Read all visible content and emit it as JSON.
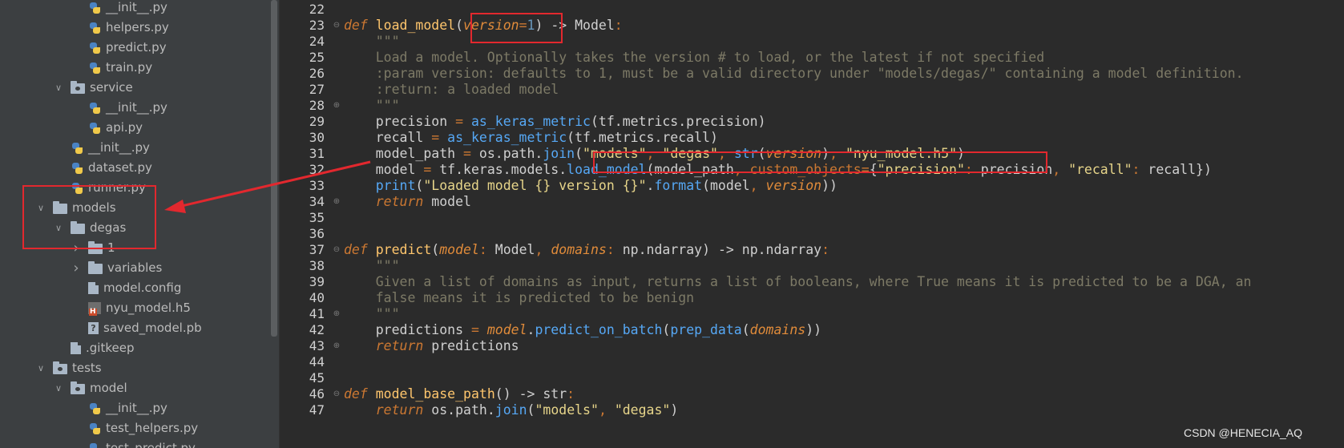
{
  "sidebar": {
    "items": [
      {
        "label": "__init__.py",
        "icon": "python-file-icon",
        "depth": 3,
        "chevron": ""
      },
      {
        "label": "helpers.py",
        "icon": "python-file-icon",
        "depth": 3,
        "chevron": ""
      },
      {
        "label": "predict.py",
        "icon": "python-file-icon",
        "depth": 3,
        "chevron": ""
      },
      {
        "label": "train.py",
        "icon": "python-file-icon",
        "depth": 3,
        "chevron": ""
      },
      {
        "label": "service",
        "icon": "package-folder-icon",
        "depth": 2,
        "chevron": "down"
      },
      {
        "label": "__init__.py",
        "icon": "python-file-icon",
        "depth": 3,
        "chevron": ""
      },
      {
        "label": "api.py",
        "icon": "python-file-icon",
        "depth": 3,
        "chevron": ""
      },
      {
        "label": "__init__.py",
        "icon": "python-file-icon",
        "depth": 2,
        "chevron": ""
      },
      {
        "label": "dataset.py",
        "icon": "python-file-icon",
        "depth": 2,
        "chevron": ""
      },
      {
        "label": "runner.py",
        "icon": "python-file-icon",
        "depth": 2,
        "chevron": ""
      },
      {
        "label": "models",
        "icon": "folder-icon",
        "depth": 1,
        "chevron": "down"
      },
      {
        "label": "degas",
        "icon": "folder-icon",
        "depth": 2,
        "chevron": "down"
      },
      {
        "label": "1",
        "icon": "folder-icon",
        "depth": 3,
        "chevron": "right"
      },
      {
        "label": "variables",
        "icon": "folder-icon",
        "depth": 3,
        "chevron": "right"
      },
      {
        "label": "model.config",
        "icon": "generic-file-icon",
        "depth": 3,
        "chevron": ""
      },
      {
        "label": "nyu_model.h5",
        "icon": "h5-file-icon",
        "depth": 3,
        "chevron": ""
      },
      {
        "label": "saved_model.pb",
        "icon": "unknown-file-icon",
        "depth": 3,
        "chevron": ""
      },
      {
        "label": ".gitkeep",
        "icon": "generic-file-icon",
        "depth": 2,
        "chevron": ""
      },
      {
        "label": "tests",
        "icon": "package-folder-icon",
        "depth": 1,
        "chevron": "down"
      },
      {
        "label": "model",
        "icon": "package-folder-icon",
        "depth": 2,
        "chevron": "down"
      },
      {
        "label": "__init__.py",
        "icon": "python-file-icon",
        "depth": 3,
        "chevron": ""
      },
      {
        "label": "test_helpers.py",
        "icon": "python-file-icon",
        "depth": 3,
        "chevron": ""
      },
      {
        "label": "test_predict.py",
        "icon": "python-file-icon",
        "depth": 3,
        "chevron": ""
      }
    ]
  },
  "editor": {
    "lines": [
      {
        "n": "22",
        "t": []
      },
      {
        "n": "23",
        "t": [
          [
            "kw",
            "def"
          ],
          [
            "txt",
            " "
          ],
          [
            "fn",
            "load_model"
          ],
          [
            "txt",
            "("
          ],
          [
            "param",
            "version"
          ],
          [
            "pu",
            "="
          ],
          [
            "num",
            "1"
          ],
          [
            "txt",
            ") -> Model"
          ],
          [
            "pu",
            ":"
          ]
        ]
      },
      {
        "n": "24",
        "t": [
          [
            "doc",
            "    \"\"\""
          ]
        ]
      },
      {
        "n": "25",
        "t": [
          [
            "doc",
            "    Load a model. Optionally takes the version # to load, or the latest if not specified"
          ]
        ]
      },
      {
        "n": "26",
        "t": [
          [
            "doc",
            "    :param version: defaults to 1, must be a valid directory under \"models/degas/\" containing a model definition."
          ]
        ]
      },
      {
        "n": "27",
        "t": [
          [
            "doc",
            "    :return: a loaded model"
          ]
        ]
      },
      {
        "n": "28",
        "t": [
          [
            "doc",
            "    \"\"\""
          ]
        ]
      },
      {
        "n": "29",
        "t": [
          [
            "txt",
            "    precision "
          ],
          [
            "pu",
            "="
          ],
          [
            "txt",
            " "
          ],
          [
            "call",
            "as_keras_metric"
          ],
          [
            "txt",
            "(tf.metrics.precision)"
          ]
        ]
      },
      {
        "n": "30",
        "t": [
          [
            "txt",
            "    recall "
          ],
          [
            "pu",
            "="
          ],
          [
            "txt",
            " "
          ],
          [
            "call",
            "as_keras_metric"
          ],
          [
            "txt",
            "(tf.metrics.recall)"
          ]
        ]
      },
      {
        "n": "31",
        "t": [
          [
            "txt",
            "    model_path "
          ],
          [
            "pu",
            "="
          ],
          [
            "txt",
            " os.path."
          ],
          [
            "call",
            "join"
          ],
          [
            "txt",
            "("
          ],
          [
            "str",
            "\"models\""
          ],
          [
            "pu",
            ", "
          ],
          [
            "str",
            "\"degas\""
          ],
          [
            "pu",
            ", "
          ],
          [
            "call",
            "str"
          ],
          [
            "txt",
            "("
          ],
          [
            "param",
            "version"
          ],
          [
            "txt",
            ")"
          ],
          [
            "pu",
            ", "
          ],
          [
            "str",
            "\"nyu_model.h5\""
          ],
          [
            "txt",
            ")"
          ]
        ]
      },
      {
        "n": "32",
        "t": [
          [
            "txt",
            "    model "
          ],
          [
            "pu",
            "="
          ],
          [
            "txt",
            " tf.keras.models."
          ],
          [
            "call",
            "load_model"
          ],
          [
            "txt",
            "(model_path"
          ],
          [
            "pu",
            ", "
          ],
          [
            "kwn",
            "custom_objects"
          ],
          [
            "pu",
            "="
          ],
          [
            "txt",
            "{"
          ],
          [
            "str",
            "\"precision\""
          ],
          [
            "pu",
            ": "
          ],
          [
            "txt",
            "precision"
          ],
          [
            "pu",
            ", "
          ],
          [
            "str",
            "\"recall\""
          ],
          [
            "pu",
            ": "
          ],
          [
            "txt",
            "recall})"
          ]
        ]
      },
      {
        "n": "33",
        "t": [
          [
            "txt",
            "    "
          ],
          [
            "call",
            "print"
          ],
          [
            "txt",
            "("
          ],
          [
            "str",
            "\"Loaded model {} version {}\""
          ],
          [
            "txt",
            "."
          ],
          [
            "call",
            "format"
          ],
          [
            "txt",
            "(model"
          ],
          [
            "pu",
            ", "
          ],
          [
            "param",
            "version"
          ],
          [
            "txt",
            "))"
          ]
        ]
      },
      {
        "n": "34",
        "t": [
          [
            "txt",
            "    "
          ],
          [
            "kw",
            "return"
          ],
          [
            "txt",
            " model"
          ]
        ]
      },
      {
        "n": "35",
        "t": []
      },
      {
        "n": "36",
        "t": []
      },
      {
        "n": "37",
        "t": [
          [
            "kw",
            "def"
          ],
          [
            "txt",
            " "
          ],
          [
            "fn",
            "predict"
          ],
          [
            "txt",
            "("
          ],
          [
            "param",
            "model"
          ],
          [
            "pu",
            ": "
          ],
          [
            "txt",
            "Model"
          ],
          [
            "pu",
            ", "
          ],
          [
            "param",
            "domains"
          ],
          [
            "pu",
            ": "
          ],
          [
            "txt",
            "np.ndarray) -> np.ndarray"
          ],
          [
            "pu",
            ":"
          ]
        ]
      },
      {
        "n": "38",
        "t": [
          [
            "doc",
            "    \"\"\""
          ]
        ]
      },
      {
        "n": "39",
        "t": [
          [
            "doc",
            "    Given a list of domains as input, returns a list of booleans, where True means it is predicted to be a DGA, an"
          ]
        ]
      },
      {
        "n": "40",
        "t": [
          [
            "doc",
            "    false means it is predicted to be benign"
          ]
        ]
      },
      {
        "n": "41",
        "t": [
          [
            "doc",
            "    \"\"\""
          ]
        ]
      },
      {
        "n": "42",
        "t": [
          [
            "txt",
            "    predictions "
          ],
          [
            "pu",
            "="
          ],
          [
            "txt",
            " "
          ],
          [
            "param",
            "model"
          ],
          [
            "txt",
            "."
          ],
          [
            "call",
            "predict_on_batch"
          ],
          [
            "txt",
            "("
          ],
          [
            "call",
            "prep_data"
          ],
          [
            "txt",
            "("
          ],
          [
            "param",
            "domains"
          ],
          [
            "txt",
            "))"
          ]
        ]
      },
      {
        "n": "43",
        "t": [
          [
            "txt",
            "    "
          ],
          [
            "kw",
            "return"
          ],
          [
            "txt",
            " predictions"
          ]
        ]
      },
      {
        "n": "44",
        "t": []
      },
      {
        "n": "45",
        "t": []
      },
      {
        "n": "46",
        "t": [
          [
            "kw",
            "def"
          ],
          [
            "txt",
            " "
          ],
          [
            "fn",
            "model_base_path"
          ],
          [
            "txt",
            "() -> str"
          ],
          [
            "pu",
            ":"
          ]
        ]
      },
      {
        "n": "47",
        "t": [
          [
            "txt",
            "    "
          ],
          [
            "kw",
            "return"
          ],
          [
            "txt",
            " os.path."
          ],
          [
            "call",
            "join"
          ],
          [
            "txt",
            "("
          ],
          [
            "str",
            "\"models\""
          ],
          [
            "pu",
            ", "
          ],
          [
            "str",
            "\"degas\""
          ],
          [
            "txt",
            ")"
          ]
        ]
      }
    ]
  },
  "watermark": "CSDN @HENECIA_AQ",
  "colors": {
    "annotation_red": "#e2282e",
    "keyword": "#cc7832",
    "string": "#e7d58a",
    "docstring": "#7d7a66",
    "call": "#56a8f5"
  }
}
